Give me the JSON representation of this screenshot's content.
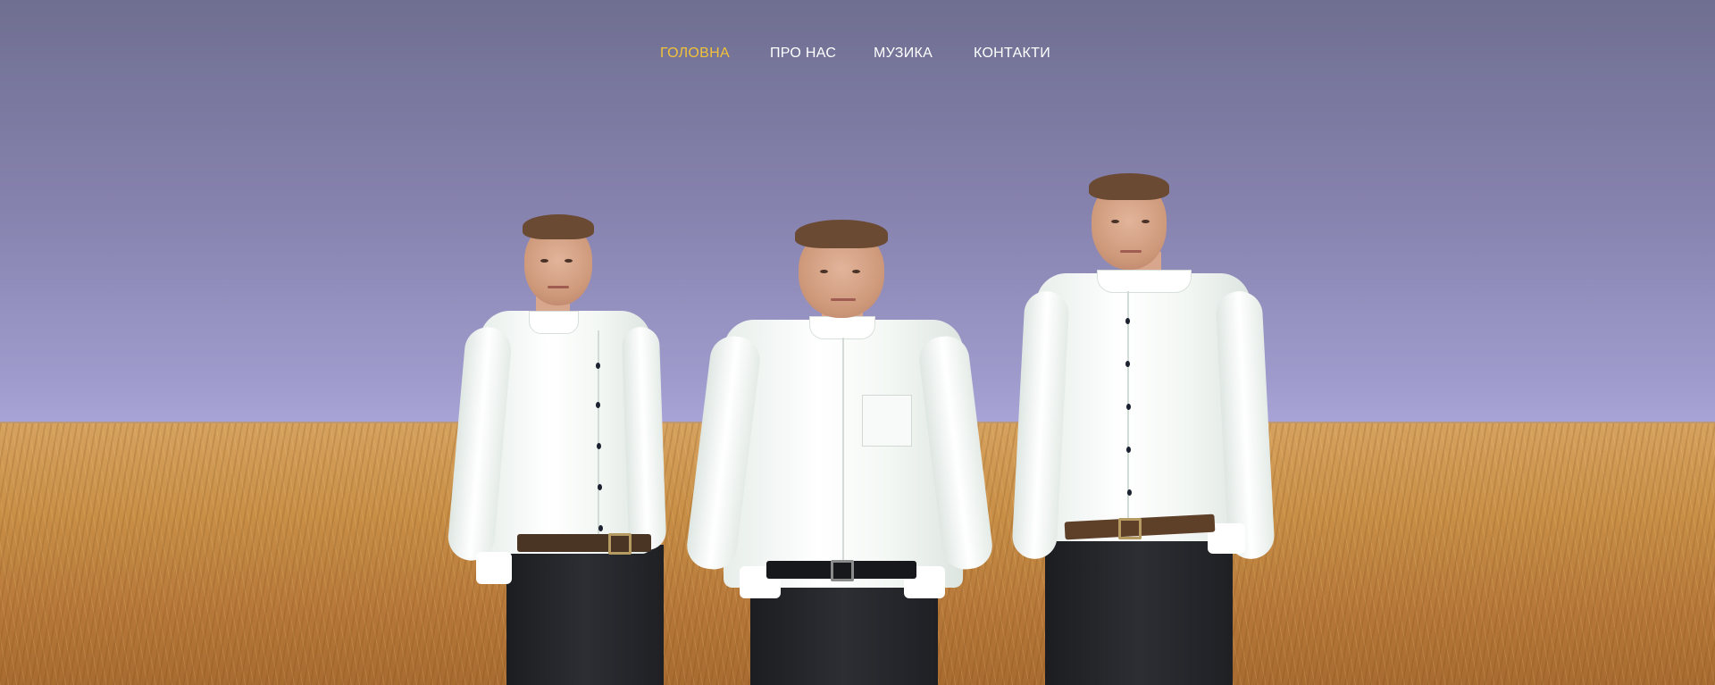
{
  "nav": {
    "items": [
      {
        "label": "ГОЛОВНА",
        "active": true
      },
      {
        "label": "ПРО НАС",
        "active": false
      },
      {
        "label": "МУЗИКА",
        "active": false
      },
      {
        "label": "КОНТАКТИ",
        "active": false
      }
    ]
  },
  "colors": {
    "nav_active": "#f2c23a",
    "nav_default": "#ffffff",
    "sky": "#a7a3d6",
    "wheat": "#c88f47"
  },
  "hero_image": {
    "scene": "three-men-in-wheat-field"
  }
}
